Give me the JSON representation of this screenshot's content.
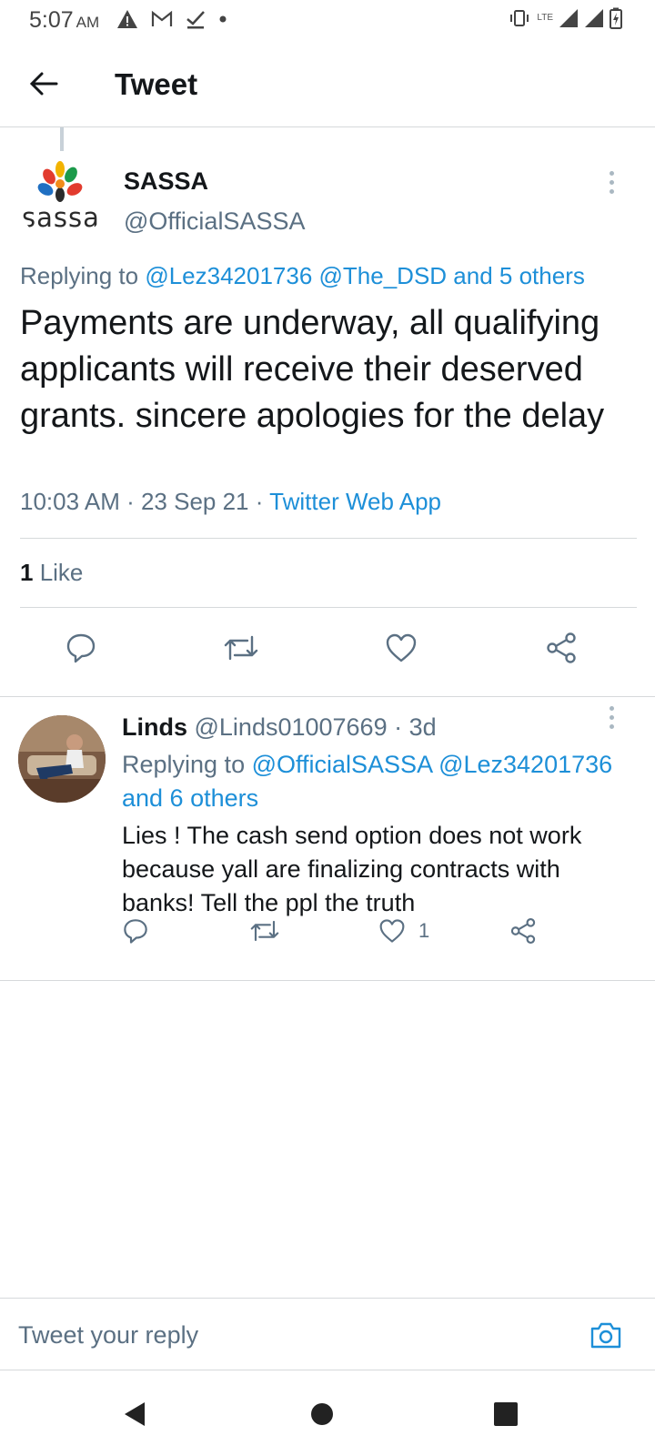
{
  "status_bar": {
    "time": "5:07",
    "ampm": "AM",
    "left_icons": [
      "warning-icon",
      "gmail-icon",
      "check-icon",
      "dot-icon"
    ],
    "network": "LTE",
    "right_icons": [
      "vibrate-icon",
      "signal-icon",
      "signal-icon",
      "battery-charging-icon"
    ]
  },
  "header": {
    "title": "Tweet",
    "back_icon": "arrow-left-icon"
  },
  "tweet": {
    "author_name": "SASSA",
    "author_handle": "@OfficialSASSA",
    "avatar_logo_text": "sassa",
    "replying_prefix": "Replying to ",
    "replying_links": "@Lez34201736 @The_DSD and 5 others",
    "text": "Payments are underway, all qualifying applicants will receive their deserved grants. sincere apologies for the delay",
    "time": "10:03 AM · 23 Sep 21 · ",
    "source": "Twitter Web App",
    "likes_count": "1",
    "likes_label": " Like"
  },
  "reply": {
    "author_name": "Linds",
    "author_handle": " @Linds01007669 · 3d",
    "replying_prefix": "Replying to ",
    "replying_links": "@OfficialSASSA @Lez34201736 and 6 others",
    "text": "Lies ! The cash send option does not work because yall are finalizing contracts with banks! Tell the ppl the truth",
    "like_count": "1"
  },
  "compose": {
    "placeholder": "Tweet your reply"
  },
  "colors": {
    "link": "#1d8fd8",
    "secondary_text": "#5b7083",
    "divider": "#d6d9db"
  }
}
